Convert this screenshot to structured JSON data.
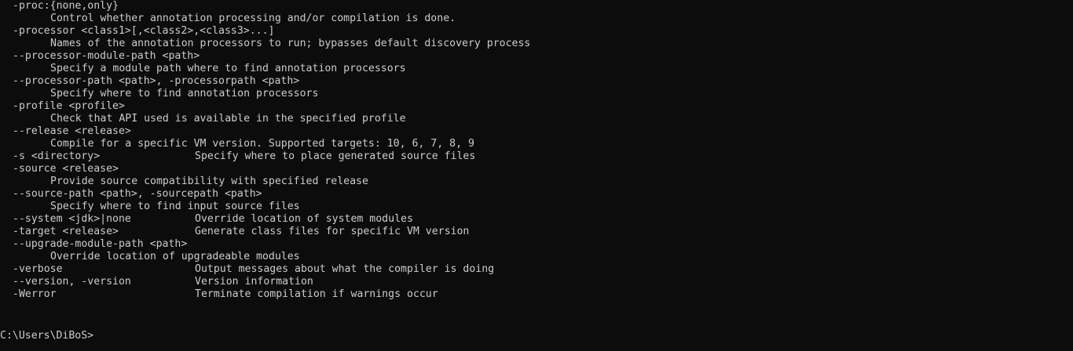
{
  "lines": [
    {
      "kind": "opt",
      "text": "-proc:{none,only}"
    },
    {
      "kind": "desc",
      "text": "Control whether annotation processing and/or compilation is done."
    },
    {
      "kind": "opt",
      "text": "-processor <class1>[,<class2>,<class3>...]"
    },
    {
      "kind": "desc",
      "text": "Names of the annotation processors to run; bypasses default discovery process"
    },
    {
      "kind": "opt",
      "text": "--processor-module-path <path>"
    },
    {
      "kind": "desc",
      "text": "Specify a module path where to find annotation processors"
    },
    {
      "kind": "opt",
      "text": "--processor-path <path>, -processorpath <path>"
    },
    {
      "kind": "desc",
      "text": "Specify where to find annotation processors"
    },
    {
      "kind": "opt",
      "text": "-profile <profile>"
    },
    {
      "kind": "desc",
      "text": "Check that API used is available in the specified profile"
    },
    {
      "kind": "opt",
      "text": "--release <release>"
    },
    {
      "kind": "desc",
      "text": "Compile for a specific VM version. Supported targets: 10, 6, 7, 8, 9"
    },
    {
      "kind": "two",
      "opt": "-s <directory>",
      "desc": "Specify where to place generated source files"
    },
    {
      "kind": "opt",
      "text": "-source <release>"
    },
    {
      "kind": "desc",
      "text": "Provide source compatibility with specified release"
    },
    {
      "kind": "opt",
      "text": "--source-path <path>, -sourcepath <path>"
    },
    {
      "kind": "desc",
      "text": "Specify where to find input source files"
    },
    {
      "kind": "two",
      "opt": "--system <jdk>|none",
      "desc": "Override location of system modules"
    },
    {
      "kind": "two",
      "opt": "-target <release>",
      "desc": "Generate class files for specific VM version"
    },
    {
      "kind": "opt",
      "text": "--upgrade-module-path <path>"
    },
    {
      "kind": "desc",
      "text": "Override location of upgradeable modules"
    },
    {
      "kind": "two",
      "opt": "-verbose",
      "desc": "Output messages about what the compiler is doing"
    },
    {
      "kind": "two",
      "opt": "--version, -version",
      "desc": "Version information"
    },
    {
      "kind": "two",
      "opt": "-Werror",
      "desc": "Terminate compilation if warnings occur"
    }
  ],
  "prompt": "C:\\Users\\DiBoS>"
}
